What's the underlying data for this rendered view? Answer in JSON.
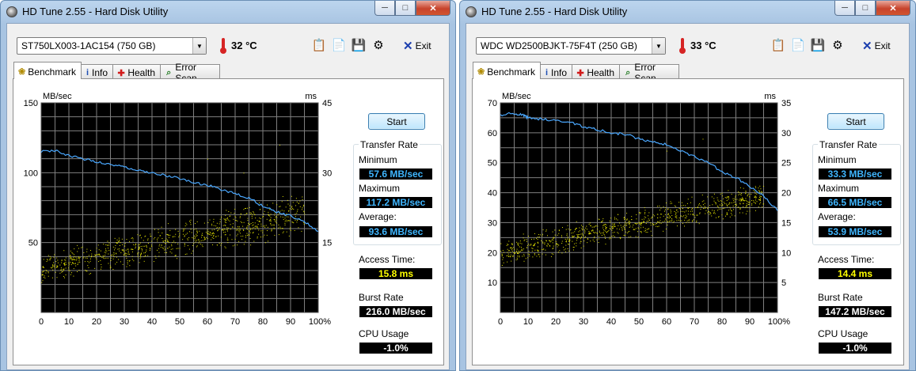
{
  "windows": [
    {
      "title": "HD Tune 2.55 - Hard Disk Utility",
      "drive": "ST750LX003-1AC154 (750 GB)",
      "temperature": "32 °C",
      "exit_label": "Exit",
      "tabs": [
        {
          "label": "Benchmark",
          "icon": "lightbulb-icon",
          "active": true
        },
        {
          "label": "Info",
          "icon": "info-icon",
          "active": false
        },
        {
          "label": "Health",
          "icon": "health-cross-icon",
          "active": false
        },
        {
          "label": "Error Scan",
          "icon": "magnifier-icon",
          "active": false
        }
      ],
      "start_label": "Start",
      "transfer_rate_title": "Transfer Rate",
      "minimum_label": "Minimum",
      "minimum_value": "57.6 MB/sec",
      "maximum_label": "Maximum",
      "maximum_value": "117.2 MB/sec",
      "average_label": "Average:",
      "average_value": "93.6 MB/sec",
      "access_time_label": "Access Time:",
      "access_time_value": "15.8 ms",
      "burst_rate_label": "Burst Rate",
      "burst_rate_value": "216.0 MB/sec",
      "cpu_usage_label": "CPU Usage",
      "cpu_usage_value": "-1.0%",
      "chart_data": {
        "type": "line",
        "ylabel_left": "MB/sec",
        "ylabel_right": "ms",
        "left_ticks": [
          "150",
          "100",
          "50"
        ],
        "left_tick_values": [
          150,
          100,
          50
        ],
        "right_ticks": [
          "45",
          "30",
          "15"
        ],
        "right_tick_values": [
          45,
          30,
          15
        ],
        "ylim_left": [
          0,
          150
        ],
        "ylim_right": [
          0,
          45
        ],
        "x_ticks": [
          "0",
          "10",
          "20",
          "30",
          "40",
          "50",
          "60",
          "70",
          "80",
          "90",
          "100%"
        ],
        "x_tick_values": [
          0,
          10,
          20,
          30,
          40,
          50,
          60,
          70,
          80,
          90,
          100
        ],
        "xlim": [
          0,
          100
        ],
        "grid": true,
        "transfer_rate_x": [
          0,
          5,
          10,
          15,
          20,
          25,
          30,
          35,
          40,
          45,
          50,
          55,
          60,
          65,
          70,
          75,
          80,
          85,
          90,
          95,
          100
        ],
        "transfer_rate_y": [
          115,
          116,
          112,
          110,
          108,
          106,
          104,
          102,
          100,
          98,
          96,
          93,
          91,
          88,
          85,
          82,
          76,
          72,
          69,
          65,
          58
        ],
        "access_scatter": {
          "x_range": [
            0,
            95
          ],
          "ms_start": [
            7,
            12
          ],
          "ms_end": [
            18,
            26
          ],
          "outliers_ms": [
            33,
            30,
            36
          ]
        }
      }
    },
    {
      "title": "HD Tune 2.55 - Hard Disk Utility",
      "drive": "WDC WD2500BJKT-75F4T (250 GB)",
      "temperature": "33 °C",
      "exit_label": "Exit",
      "tabs": [
        {
          "label": "Benchmark",
          "icon": "lightbulb-icon",
          "active": true
        },
        {
          "label": "Info",
          "icon": "info-icon",
          "active": false
        },
        {
          "label": "Health",
          "icon": "health-cross-icon",
          "active": false
        },
        {
          "label": "Error Scan",
          "icon": "magnifier-icon",
          "active": false
        }
      ],
      "start_label": "Start",
      "transfer_rate_title": "Transfer Rate",
      "minimum_label": "Minimum",
      "minimum_value": "33.3 MB/sec",
      "maximum_label": "Maximum",
      "maximum_value": "66.5 MB/sec",
      "average_label": "Average:",
      "average_value": "53.9 MB/sec",
      "access_time_label": "Access Time:",
      "access_time_value": "14.4 ms",
      "burst_rate_label": "Burst Rate",
      "burst_rate_value": "147.2 MB/sec",
      "cpu_usage_label": "CPU Usage",
      "cpu_usage_value": "-1.0%",
      "chart_data": {
        "type": "line",
        "ylabel_left": "MB/sec",
        "ylabel_right": "ms",
        "left_ticks": [
          "70",
          "60",
          "50",
          "40",
          "30",
          "20",
          "10"
        ],
        "left_tick_values": [
          70,
          60,
          50,
          40,
          30,
          20,
          10
        ],
        "right_ticks": [
          "35",
          "30",
          "25",
          "20",
          "15",
          "10",
          "5"
        ],
        "right_tick_values": [
          35,
          30,
          25,
          20,
          15,
          10,
          5
        ],
        "ylim_left": [
          0,
          70
        ],
        "ylim_right": [
          0,
          35
        ],
        "x_ticks": [
          "0",
          "10",
          "20",
          "30",
          "40",
          "50",
          "60",
          "70",
          "80",
          "90",
          "100%"
        ],
        "x_tick_values": [
          0,
          10,
          20,
          30,
          40,
          50,
          60,
          70,
          80,
          90,
          100
        ],
        "xlim": [
          0,
          100
        ],
        "grid": true,
        "transfer_rate_x": [
          0,
          5,
          8,
          10,
          15,
          20,
          25,
          30,
          35,
          40,
          45,
          50,
          55,
          60,
          65,
          70,
          75,
          80,
          85,
          90,
          95,
          100
        ],
        "transfer_rate_y": [
          66,
          66.5,
          66,
          65,
          64.5,
          64,
          63.5,
          62,
          61,
          60,
          59.5,
          58,
          57,
          56,
          54,
          52,
          50,
          47,
          45,
          42,
          39,
          34
        ],
        "access_scatter": {
          "x_range": [
            0,
            95
          ],
          "ms_start": [
            8,
            12
          ],
          "ms_end": [
            18,
            22
          ],
          "outliers_ms": [
            27,
            29
          ]
        }
      }
    }
  ]
}
